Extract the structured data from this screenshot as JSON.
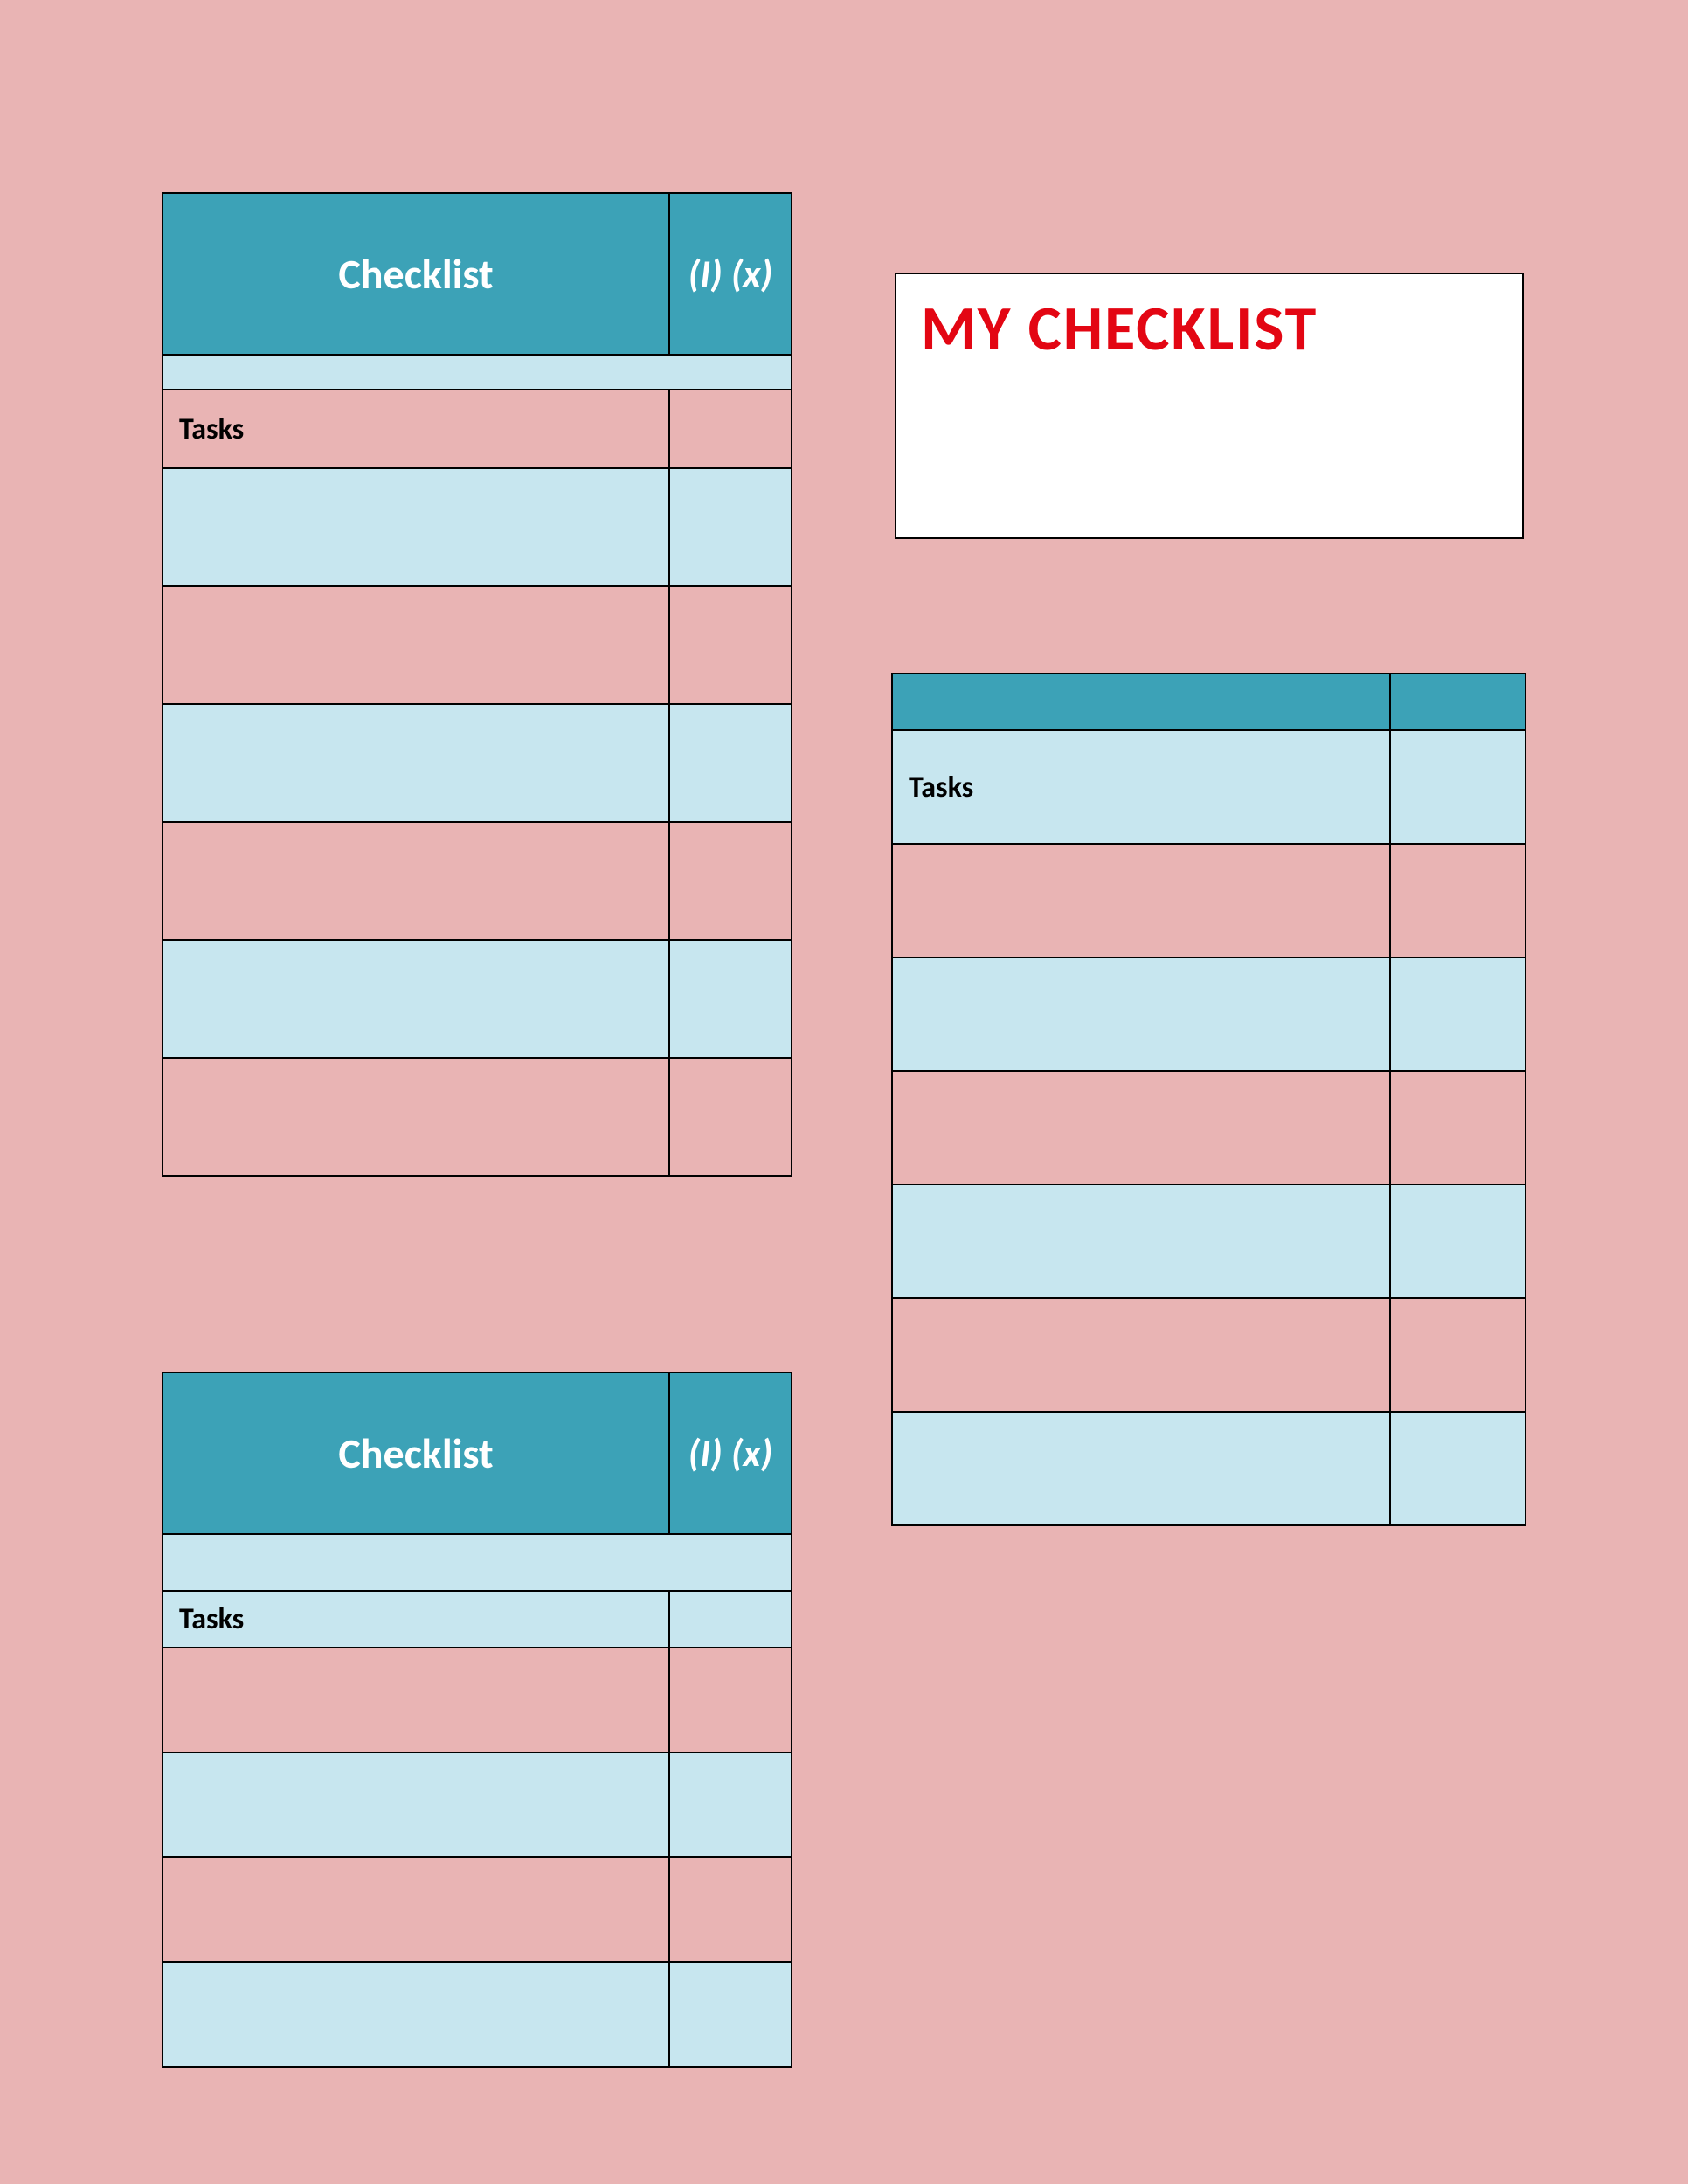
{
  "title_card": "MY CHECKLIST",
  "checklist1": {
    "header_main": "Checklist",
    "header_ix": "(I) (x)",
    "tasks_label": "Tasks",
    "rows": [
      "",
      "",
      "",
      "",
      "",
      ""
    ]
  },
  "checklist2": {
    "header_main": "Checklist",
    "header_ix": "(I) (x)",
    "tasks_label": "Tasks",
    "rows": [
      "",
      "",
      "",
      ""
    ]
  },
  "checklist3": {
    "header_main": "",
    "header_ix": "",
    "tasks_label": "Tasks",
    "rows": [
      "",
      "",
      "",
      "",
      "",
      ""
    ]
  }
}
